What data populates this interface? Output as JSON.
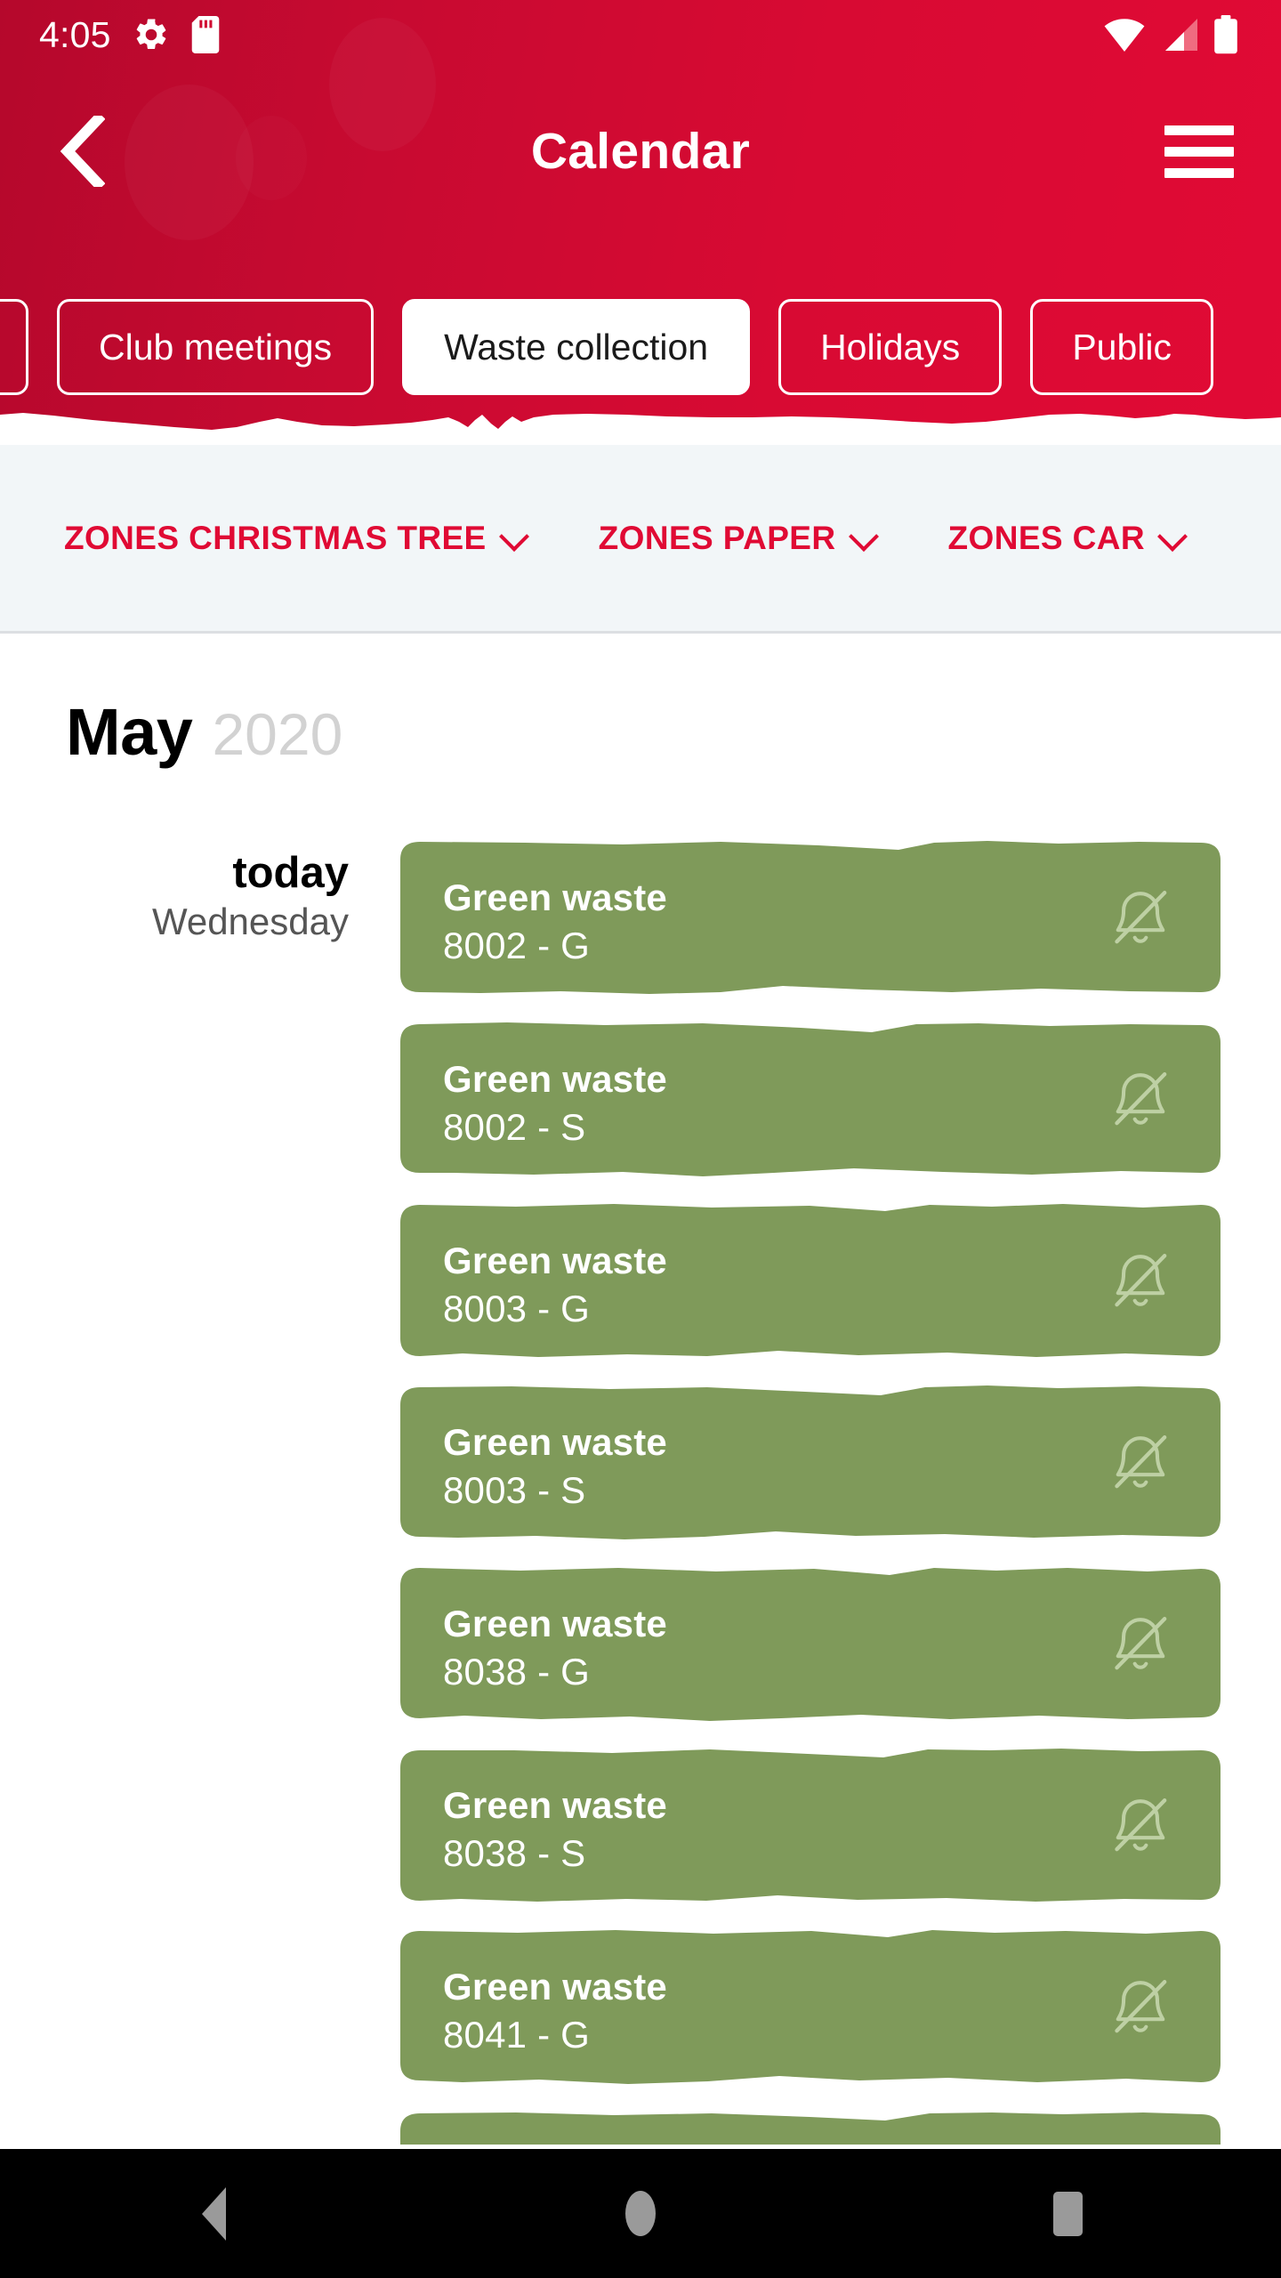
{
  "status_bar": {
    "time": "4:05",
    "icons": [
      "gear-icon",
      "sd-card-icon",
      "wifi-icon",
      "cellular-signal-icon",
      "battery-icon"
    ]
  },
  "app_bar": {
    "title": "Calendar",
    "back_icon": "chevron-left-icon",
    "menu_icon": "hamburger-menu-icon"
  },
  "category_chips": [
    {
      "label": "",
      "selected": false,
      "partial": true
    },
    {
      "label": "Club meetings",
      "selected": false,
      "partial": false
    },
    {
      "label": "Waste collection",
      "selected": true,
      "partial": false
    },
    {
      "label": "Holidays",
      "selected": false,
      "partial": false
    },
    {
      "label": "Public",
      "selected": false,
      "partial": false
    }
  ],
  "zone_filters": [
    {
      "label": "ZONES CHRISTMAS TREE",
      "icon": "chevron-down-icon"
    },
    {
      "label": "ZONES PAPER",
      "icon": "chevron-down-icon"
    },
    {
      "label": "ZONES CAR",
      "icon": "chevron-down-icon"
    }
  ],
  "month": {
    "name": "May",
    "year": "2020"
  },
  "events": [
    {
      "day_primary": "today",
      "day_secondary": "Wednesday",
      "title": "Green waste",
      "subtitle": "8002 - G",
      "icon": "bell-off-icon"
    },
    {
      "day_primary": "",
      "day_secondary": "",
      "title": "Green waste",
      "subtitle": "8002 - S",
      "icon": "bell-off-icon"
    },
    {
      "day_primary": "",
      "day_secondary": "",
      "title": "Green waste",
      "subtitle": "8003 - G",
      "icon": "bell-off-icon"
    },
    {
      "day_primary": "",
      "day_secondary": "",
      "title": "Green waste",
      "subtitle": "8003 - S",
      "icon": "bell-off-icon"
    },
    {
      "day_primary": "",
      "day_secondary": "",
      "title": "Green waste",
      "subtitle": "8038 - G",
      "icon": "bell-off-icon"
    },
    {
      "day_primary": "",
      "day_secondary": "",
      "title": "Green waste",
      "subtitle": "8038 - S",
      "icon": "bell-off-icon"
    },
    {
      "day_primary": "",
      "day_secondary": "",
      "title": "Green waste",
      "subtitle": "8041 - G",
      "icon": "bell-off-icon"
    },
    {
      "day_primary": "",
      "day_secondary": "",
      "title": "",
      "subtitle": "",
      "icon": "bell-off-icon"
    }
  ],
  "nav_bar": {
    "back": "back-triangle-icon",
    "home": "home-circle-icon",
    "recents": "recents-square-icon"
  },
  "colors": {
    "brand_red": "#d80a33",
    "brand_red_dark": "#b5082c",
    "card_green": "#7f9a5a",
    "zones_bg": "#f2f6f8",
    "year_gray": "#d2d2d2",
    "nav_icon_gray": "#9a9a9a"
  }
}
